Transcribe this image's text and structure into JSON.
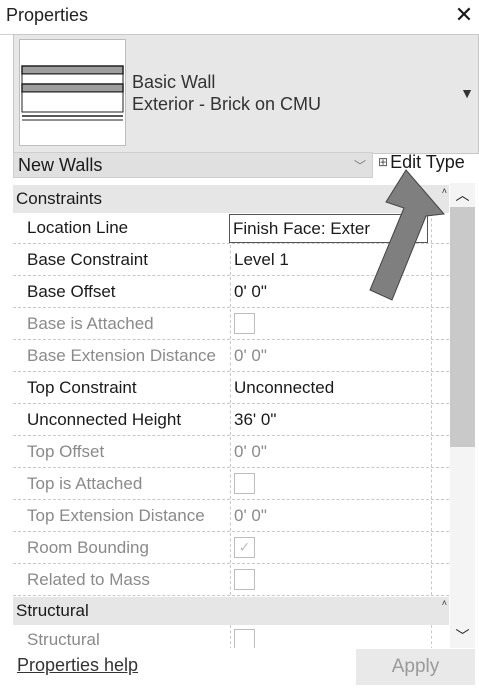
{
  "window": {
    "title": "Properties"
  },
  "type_selector": {
    "line1": "Basic Wall",
    "line2": "Exterior - Brick on CMU"
  },
  "filter": {
    "selected": "New Walls",
    "edit_type_label": "Edit Type"
  },
  "groups": [
    {
      "label": "Constraints",
      "rows": [
        {
          "name": "Location Line",
          "value": "Finish Face: Exter",
          "disabled": false,
          "checkbox": false
        },
        {
          "name": "Base Constraint",
          "value": "Level 1",
          "disabled": false,
          "checkbox": false
        },
        {
          "name": "Base Offset",
          "value": "0'  0\"",
          "disabled": false,
          "checkbox": false
        },
        {
          "name": "Base is Attached",
          "value": "",
          "disabled": true,
          "checkbox": true,
          "checked": false
        },
        {
          "name": "Base Extension Distance",
          "value": "0'  0\"",
          "disabled": true,
          "checkbox": false
        },
        {
          "name": "Top Constraint",
          "value": "Unconnected",
          "disabled": false,
          "checkbox": false
        },
        {
          "name": "Unconnected Height",
          "value": "36'  0\"",
          "disabled": false,
          "checkbox": false
        },
        {
          "name": "Top Offset",
          "value": "0'  0\"",
          "disabled": true,
          "checkbox": false
        },
        {
          "name": "Top is Attached",
          "value": "",
          "disabled": true,
          "checkbox": true,
          "checked": false
        },
        {
          "name": "Top Extension Distance",
          "value": "0'  0\"",
          "disabled": true,
          "checkbox": false
        },
        {
          "name": "Room Bounding",
          "value": "",
          "disabled": true,
          "checkbox": true,
          "checked": true
        },
        {
          "name": "Related to Mass",
          "value": "",
          "disabled": true,
          "checkbox": true,
          "checked": false
        }
      ]
    },
    {
      "label": "Structural",
      "rows": [
        {
          "name": "Structural",
          "value": "",
          "disabled": true,
          "checkbox": true,
          "checked": false
        }
      ]
    }
  ],
  "footer": {
    "help_label": "Properties help",
    "apply_label": "Apply"
  },
  "icons": {
    "close": "close-icon",
    "dropdown": "chevron-down-icon",
    "edit_type": "edit-type-icon",
    "collapse": "collapse-caret-icon",
    "scroll_up": "chevron-up-icon",
    "scroll_down": "chevron-down-icon",
    "checkmark": "checkmark-icon"
  },
  "colors": {
    "accent_arrow": "#7f7f7f",
    "header_bg": "#e6e6e6",
    "disabled_text": "#8a8a8a"
  }
}
